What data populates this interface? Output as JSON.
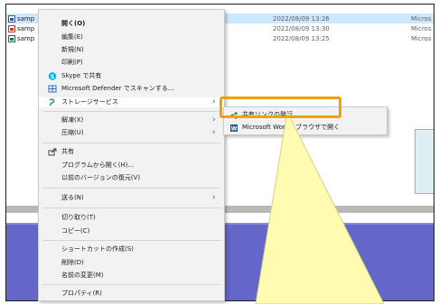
{
  "files": [
    {
      "name": "samp",
      "date": "2022/08/09 13:26",
      "type": "Micros",
      "kind": "word",
      "selected": true
    },
    {
      "name": "samp",
      "date": "2022/08/09 13:30",
      "type": "Micros",
      "kind": "ppt",
      "selected": false
    },
    {
      "name": "samp",
      "date": "2022/08/09 13:25",
      "type": "Micros",
      "kind": "xls",
      "selected": false
    }
  ],
  "menu": {
    "open": "開く(O)",
    "edit": "編集(E)",
    "new": "新規(N)",
    "print": "印刷(P)",
    "skype_share": "Skype で共有",
    "defender_scan": "Microsoft Defender でスキャンする...",
    "storage_service": "ストレージサービス",
    "extract": "解凍(X)",
    "compress": "圧縮(U)",
    "share": "共有",
    "open_with": "プログラムから開く(H)...",
    "restore_previous": "以前のバージョンの復元(V)",
    "send_to": "送る(N)",
    "cut": "切り取り(T)",
    "copy": "コピー(C)",
    "create_shortcut": "ショートカットの作成(S)",
    "delete": "削除(D)",
    "rename": "名前の変更(M)",
    "properties": "プロパティ(R)"
  },
  "submenu": {
    "issue_share_link": "共有リンクの発行...",
    "open_in_word": "Microsoft Wordをブラウザで開く"
  },
  "colors": {
    "callout_border": "#f0a000",
    "callout_fill": "#fffbb0",
    "desktop_purple": "#6466c8",
    "selection": "#cce8ff"
  },
  "icons": {
    "skype": "skype-icon",
    "defender": "defender-shield-icon",
    "storage": "storage-service-icon",
    "share": "share-icon",
    "share_link": "share-link-icon",
    "submenu_arrow": "chevron-right-icon"
  }
}
